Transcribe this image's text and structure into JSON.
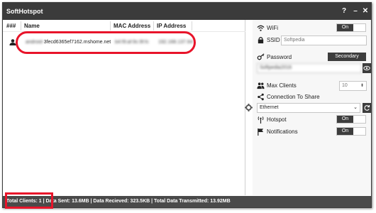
{
  "window": {
    "title": "SoftHotspot",
    "help_label": "?",
    "minimize_label": "–",
    "close_label": "✕"
  },
  "table": {
    "headers": [
      "###",
      "Name",
      "MAC Address",
      "IP Address"
    ],
    "rows": [
      {
        "name": "android-3fecd6365ef7162.mshome.net",
        "name_visible": "3fecd6365ef7162.mshome.net",
        "mac": "b4:f9:af:9c:9f:fc",
        "ip": "192.168.137.64"
      }
    ]
  },
  "settings": {
    "wifi_label": "WiFi",
    "wifi_toggle": "On",
    "ssid_label": "SSID",
    "ssid_value": "Softpedia",
    "password_label": "Password",
    "password_type": "Secondary",
    "password_value": "Softpedia2016",
    "max_clients_label": "Max Clients",
    "max_clients_value": "10",
    "connection_label": "Connection To Share",
    "connection_value": "Ethernet",
    "hotspot_label": "Hotspot",
    "hotspot_toggle": "On",
    "notifications_label": "Notifications",
    "notifications_toggle": "On"
  },
  "status": {
    "text": "Total Clients: 1 | Data Sent: 13.6MB | Data Recieved: 323.5KB | Total Data Transmitted: 13.92MB"
  },
  "colors": {
    "titlebar": "#3b3b3b",
    "accent_dark": "#3d3d3d",
    "highlight": "#e8142a",
    "statusbar": "#4a4a4a"
  }
}
